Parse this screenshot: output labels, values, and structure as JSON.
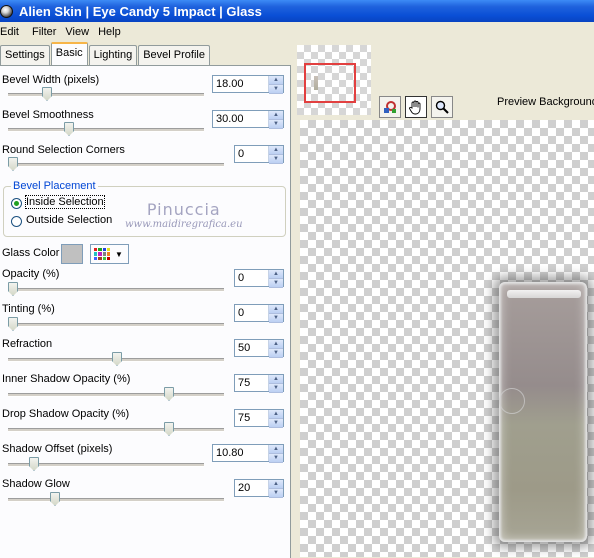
{
  "window": {
    "title": "Alien Skin | Eye Candy 5 Impact | Glass"
  },
  "menu": [
    "Edit",
    "Filter",
    "View",
    "Help"
  ],
  "tabs": [
    {
      "label": "Settings",
      "active": false
    },
    {
      "label": "Basic",
      "active": true
    },
    {
      "label": "Lighting",
      "active": false
    },
    {
      "label": "Bevel Profile",
      "active": false
    }
  ],
  "controls": {
    "bevel_width": {
      "label": "Bevel Width (pixels)",
      "value": "18.00",
      "level": 0.18
    },
    "bevel_smoothness": {
      "label": "Bevel Smoothness",
      "value": "30.00",
      "level": 0.3
    },
    "round_corners": {
      "label": "Round Selection Corners",
      "value": "0",
      "level": 0
    },
    "opacity": {
      "label": "Opacity (%)",
      "value": "0",
      "level": 0
    },
    "tinting": {
      "label": "Tinting (%)",
      "value": "0",
      "level": 0
    },
    "refraction": {
      "label": "Refraction",
      "value": "50",
      "level": 0.5
    },
    "inner_shadow": {
      "label": "Inner Shadow Opacity (%)",
      "value": "75",
      "level": 0.75
    },
    "drop_shadow": {
      "label": "Drop Shadow Opacity (%)",
      "value": "75",
      "level": 0.75
    },
    "shadow_offset": {
      "label": "Shadow Offset (pixels)",
      "value": "10.80",
      "level": 0.11
    },
    "shadow_glow": {
      "label": "Shadow Glow",
      "value": "20",
      "level": 0.2
    }
  },
  "bevel_placement": {
    "legend": "Bevel Placement",
    "inside": "Inside Selection",
    "outside": "Outside Selection",
    "selected": "inside"
  },
  "glass_color": {
    "label": "Glass Color",
    "swatch": "#c0c0c0"
  },
  "watermark": {
    "name": "Pinuccia",
    "url": "www.maidiregrafica.eu"
  },
  "preview": {
    "background_label": "Preview Background"
  },
  "icons": {
    "app": "eye-candy-icon",
    "toolbar": [
      "navigator-icon",
      "hand-icon",
      "zoom-icon"
    ]
  }
}
